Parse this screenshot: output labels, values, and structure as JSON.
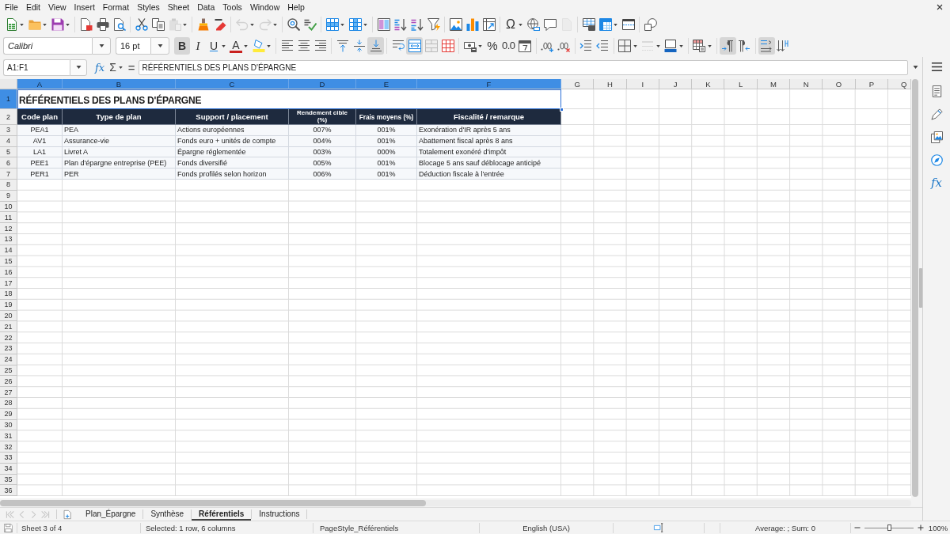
{
  "menu_bar": {
    "items": [
      "File",
      "Edit",
      "View",
      "Insert",
      "Format",
      "Styles",
      "Sheet",
      "Data",
      "Tools",
      "Window",
      "Help"
    ]
  },
  "standard_toolbar": {
    "special_character": "Ω",
    "disabled": {
      "paste": true,
      "undo": true,
      "redo": true,
      "headers_footers": true
    }
  },
  "formatting_toolbar": {
    "font_name": "Calibri",
    "font_size": "16 pt",
    "bold": {
      "label": "B",
      "pressed": true
    },
    "italic": {
      "label": "I",
      "pressed": false
    },
    "underline": {
      "label": "U",
      "pressed": false
    },
    "font_color": {
      "label": "A"
    },
    "percent": {
      "label": "%"
    },
    "number": {
      "label": "0.0"
    },
    "pressed": {
      "align_left": false,
      "align_center": false,
      "align_right": false,
      "align_top": false,
      "align_middle": false,
      "align_bottom": true,
      "wrap_text": false,
      "merge_center": true,
      "para_ltr": true,
      "para_rtl": false,
      "text_ltr": true,
      "text_ttb": false
    },
    "disabled": {
      "border_style": true
    }
  },
  "formula_bar": {
    "name_box": "A1:F1",
    "function_wizard": "fx",
    "sum": "Σ",
    "equals": "=",
    "content": "RÉFÉRENTIELS DES PLANS D'ÉPARGNE"
  },
  "sheet": {
    "columns": [
      {
        "label": "A",
        "selected": true
      },
      {
        "label": "B",
        "selected": true
      },
      {
        "label": "C",
        "selected": true
      },
      {
        "label": "D",
        "selected": true
      },
      {
        "label": "E",
        "selected": true
      },
      {
        "label": "F",
        "selected": true
      },
      {
        "label": "G",
        "selected": false
      },
      {
        "label": "H",
        "selected": false
      },
      {
        "label": "I",
        "selected": false
      },
      {
        "label": "J",
        "selected": false
      },
      {
        "label": "K",
        "selected": false
      },
      {
        "label": "L",
        "selected": false
      },
      {
        "label": "M",
        "selected": false
      },
      {
        "label": "N",
        "selected": false
      },
      {
        "label": "O",
        "selected": false
      },
      {
        "label": "P",
        "selected": false
      },
      {
        "label": "Q",
        "selected": false
      }
    ],
    "rows": [
      {
        "label": "1",
        "selected": true
      },
      {
        "label": "2",
        "selected": false
      },
      {
        "label": "3",
        "selected": false
      },
      {
        "label": "4",
        "selected": false
      },
      {
        "label": "5",
        "selected": false
      },
      {
        "label": "6",
        "selected": false
      },
      {
        "label": "7",
        "selected": false
      },
      {
        "label": "8",
        "selected": false
      },
      {
        "label": "9",
        "selected": false
      },
      {
        "label": "10",
        "selected": false
      },
      {
        "label": "11",
        "selected": false
      },
      {
        "label": "12",
        "selected": false
      },
      {
        "label": "13",
        "selected": false
      },
      {
        "label": "14",
        "selected": false
      },
      {
        "label": "15",
        "selected": false
      },
      {
        "label": "16",
        "selected": false
      },
      {
        "label": "17",
        "selected": false
      },
      {
        "label": "18",
        "selected": false
      },
      {
        "label": "19",
        "selected": false
      },
      {
        "label": "20",
        "selected": false
      },
      {
        "label": "21",
        "selected": false
      },
      {
        "label": "22",
        "selected": false
      },
      {
        "label": "23",
        "selected": false
      },
      {
        "label": "24",
        "selected": false
      },
      {
        "label": "25",
        "selected": false
      },
      {
        "label": "26",
        "selected": false
      },
      {
        "label": "27",
        "selected": false
      },
      {
        "label": "28",
        "selected": false
      },
      {
        "label": "29",
        "selected": false
      },
      {
        "label": "30",
        "selected": false
      },
      {
        "label": "31",
        "selected": false
      },
      {
        "label": "32",
        "selected": false
      },
      {
        "label": "33",
        "selected": false
      },
      {
        "label": "34",
        "selected": false
      },
      {
        "label": "35",
        "selected": false
      },
      {
        "label": "36",
        "selected": false
      }
    ],
    "title": "RÉFÉRENTIELS DES PLANS D'ÉPARGNE",
    "header": [
      "Code plan",
      "Type de plan",
      "Support / placement",
      "Rendement cible (%)",
      "Frais moyens (%)",
      "Fiscalité / remarque"
    ],
    "records": [
      [
        "PEA1",
        "PEA",
        "Actions européennes",
        "007%",
        "001%",
        "Exonération d'IR après 5 ans"
      ],
      [
        "AV1",
        "Assurance-vie",
        "Fonds euro + unités de compte",
        "004%",
        "001%",
        "Abattement fiscal après 8 ans"
      ],
      [
        "LA1",
        "Livret A",
        "Épargne réglementée",
        "003%",
        "000%",
        "Totalement exonéré d'impôt"
      ],
      [
        "PEE1",
        "Plan d'épargne entreprise (PEE)",
        "Fonds diversifié",
        "005%",
        "001%",
        "Blocage 5 ans sauf déblocage anticipé"
      ],
      [
        "PER1",
        "PER",
        "Fonds profilés selon horizon",
        "006%",
        "001%",
        "Déduction fiscale à l'entrée"
      ]
    ]
  },
  "sheet_bar": {
    "navigation_disabled": true,
    "tabs": [
      {
        "label": "Plan_Épargne",
        "selected": false
      },
      {
        "label": "Synthèse",
        "selected": false
      },
      {
        "label": "Référentiels",
        "selected": true
      },
      {
        "label": "Instructions",
        "selected": false
      }
    ]
  },
  "status_bar": {
    "sheet": "Sheet 3 of 4",
    "selection": "Selected: 1 row, 6 columns",
    "page_style": "PageStyle_Référentiels",
    "language": "English (USA)",
    "summary": "Average: ; Sum: 0",
    "zoom": {
      "level": 0.5,
      "reading": "100%"
    }
  },
  "sidebar": {
    "functions": "fx"
  }
}
